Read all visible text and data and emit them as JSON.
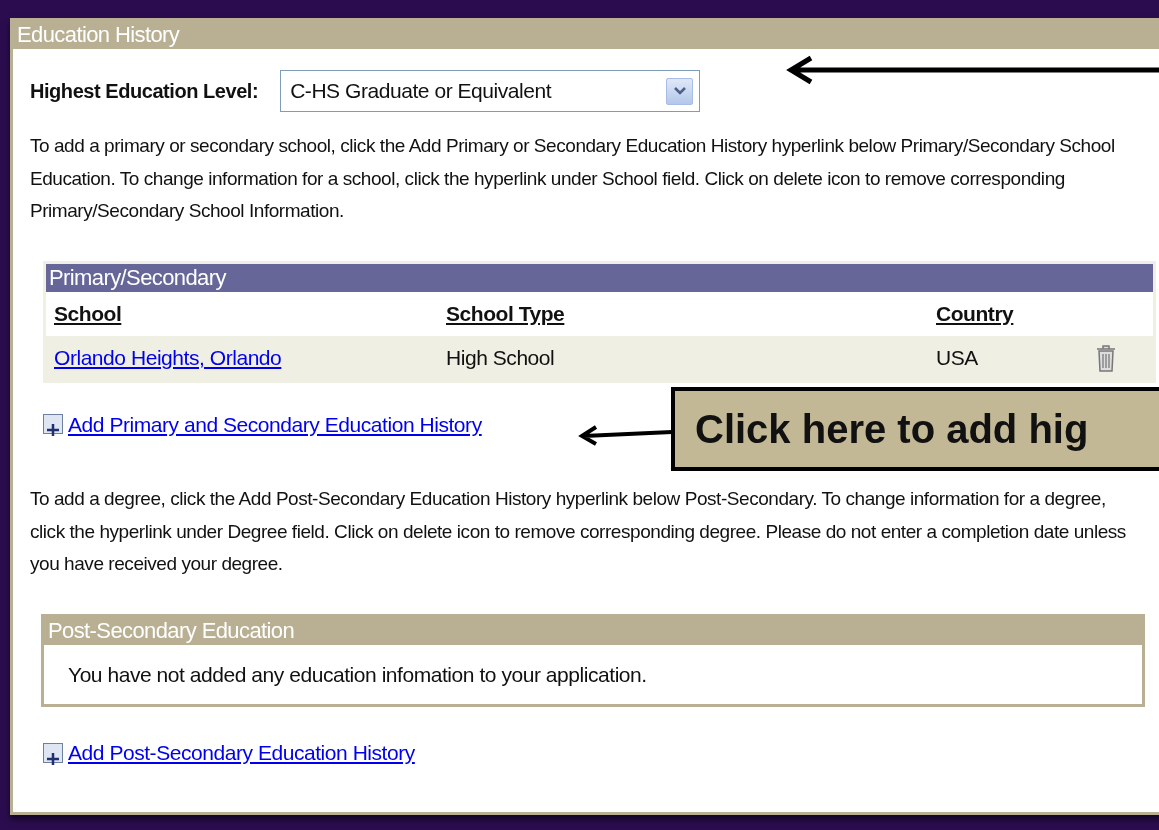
{
  "section": {
    "title": "Education History"
  },
  "education_level": {
    "label": "Highest Education Level:",
    "value": "C-HS Graduate or Equivalent"
  },
  "primary_intro": "To add a primary or secondary school, click the Add Primary or Secondary Education History hyperlink below Primary/Secondary School Education. To change information for a school, click the hyperlink under School field. Click on delete icon to remove corresponding Primary/Secondary School Information.",
  "primary_table": {
    "title": "Primary/Secondary",
    "columns": [
      "School",
      "School Type",
      "Country"
    ],
    "rows": [
      {
        "school": "Orlando Heights, Orlando",
        "school_type": "High School",
        "country": "USA"
      }
    ]
  },
  "add_primary_link": "Add Primary and Secondary Education History",
  "post_intro": "To add a degree, click the Add Post-Secondary Education History hyperlink below Post-Secondary. To change information for a degree, click the hyperlink under Degree field. Click on delete icon to remove corresponding degree. Please do not enter a completion date unless you have received your degree.",
  "post_table": {
    "title": "Post-Secondary Education",
    "empty_message": "You have not added any education infomation to your application."
  },
  "add_post_link": "Add Post-Secondary Education History",
  "callout": "Click here to add hig"
}
